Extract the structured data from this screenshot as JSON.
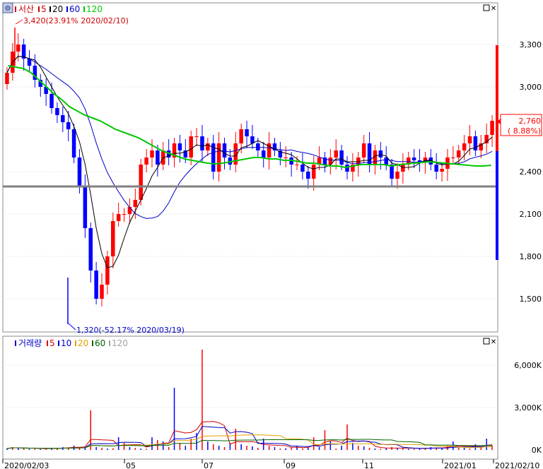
{
  "price_panel": {
    "legend": {
      "name": "서산",
      "ma_items": [
        {
          "label": "5",
          "color": "#d00000"
        },
        {
          "label": "20",
          "color": "#000000"
        },
        {
          "label": "60",
          "color": "#0000c8"
        },
        {
          "label": "120",
          "color": "#00c800"
        }
      ]
    },
    "max_annotation": "3,420(23.91% 2020/02/10)",
    "min_annotation": "1,320(-52.17% 2020/03/19)",
    "current_price": "2,760",
    "current_change": "( 8.88%)",
    "y_ticks": [
      "3,300",
      "3,000",
      "2,700",
      "2,400",
      "2,100",
      "1,800",
      "1,500"
    ]
  },
  "volume_panel": {
    "legend": {
      "name": "거래량",
      "ma_items": [
        {
          "label": "5",
          "color": "#d00000"
        },
        {
          "label": "10",
          "color": "#0000c8"
        },
        {
          "label": "20",
          "color": "#e0a000"
        },
        {
          "label": "60",
          "color": "#006400"
        },
        {
          "label": "120",
          "color": "#a0a0a0"
        }
      ]
    },
    "y_ticks": [
      "6,000K",
      "3,000K",
      "0K"
    ]
  },
  "x_ticks": [
    "2020/02/03",
    "05",
    "07",
    "09",
    "11",
    "2021/01",
    "2021/02/10"
  ],
  "colors": {
    "up": "#ff0000",
    "down": "#0000ff",
    "ma5": "#d00000",
    "ma20": "#000000",
    "ma60": "#0000c8",
    "ma120": "#00c800",
    "support": "#808080"
  },
  "chart_data": [
    {
      "type": "candlestick",
      "title": "서산",
      "ylim": [
        1300,
        3400
      ],
      "y_ticks": [
        1500,
        1800,
        2100,
        2400,
        2700,
        3000,
        3300
      ],
      "horizontal_line": 2290,
      "max_point": {
        "value": 3420,
        "date": "2020/02/10",
        "change_pct": 23.91
      },
      "min_point": {
        "value": 1320,
        "date": "2020/03/19",
        "change_pct": -52.17
      },
      "last_close": 2760,
      "last_change_pct": 8.88,
      "closes": [
        3100,
        3250,
        3300,
        3200,
        3150,
        3050,
        3000,
        2950,
        2850,
        2800,
        2750,
        2700,
        2500,
        2300,
        2000,
        1700,
        1500,
        1600,
        1800,
        2050,
        2100,
        2100,
        2150,
        2200,
        2450,
        2500,
        2550,
        2450,
        2550,
        2500,
        2600,
        2550,
        2500,
        2650,
        2650,
        2550,
        2600,
        2400,
        2600,
        2500,
        2450,
        2600,
        2700,
        2650,
        2600,
        2550,
        2500,
        2600,
        2550,
        2500,
        2500,
        2450,
        2450,
        2400,
        2350,
        2450,
        2500,
        2450,
        2500,
        2550,
        2450,
        2400,
        2450,
        2500,
        2600,
        2450,
        2550,
        2500,
        2450,
        2350,
        2400,
        2450,
        2500,
        2480,
        2470,
        2500,
        2450,
        2400,
        2420,
        2500,
        2500,
        2550,
        2600,
        2650,
        2550,
        2600,
        2660,
        2760
      ],
      "ma120": [
        3150,
        3140,
        3130,
        3100,
        3050,
        3000,
        2950,
        2910,
        2860,
        2830,
        2800,
        2780,
        2760,
        2730,
        2700,
        2680,
        2660,
        2640,
        2610,
        2580,
        2550,
        2530,
        2510,
        2490,
        2480,
        2470,
        2460,
        2455,
        2460,
        2470,
        2480,
        2490,
        2500,
        2500,
        2490,
        2490,
        2480,
        2480,
        2470,
        2460,
        2460,
        2450,
        2440,
        2440,
        2430,
        2440,
        2450,
        2450,
        2450,
        2450,
        2440,
        2450,
        2455,
        2460,
        2465,
        2470,
        2465,
        2460,
        2455,
        2450,
        2445,
        2440,
        2440,
        2445
      ]
    },
    {
      "type": "bar",
      "title": "거래량",
      "ylim": [
        0,
        7200
      ],
      "y_ticks": [
        0,
        3000,
        6000
      ],
      "unit": "K",
      "values": [
        100,
        200,
        150,
        100,
        80,
        120,
        60,
        90,
        150,
        120,
        200,
        180,
        300,
        150,
        250,
        2800,
        200,
        150,
        100,
        120,
        900,
        500,
        200,
        150,
        100,
        80,
        900,
        700,
        600,
        200,
        4400,
        500,
        300,
        800,
        1200,
        7100,
        600,
        400,
        300,
        200,
        500,
        1500,
        400,
        300,
        250,
        150,
        800,
        300,
        200,
        100,
        120,
        200,
        300,
        100,
        150,
        900,
        200,
        1400,
        600,
        100,
        300,
        1800,
        500,
        300,
        250,
        150,
        100,
        80,
        120,
        200,
        150,
        100,
        80,
        90,
        100,
        150,
        200,
        150,
        100,
        300,
        600,
        200,
        150,
        100,
        400,
        200,
        800,
        300
      ]
    }
  ]
}
